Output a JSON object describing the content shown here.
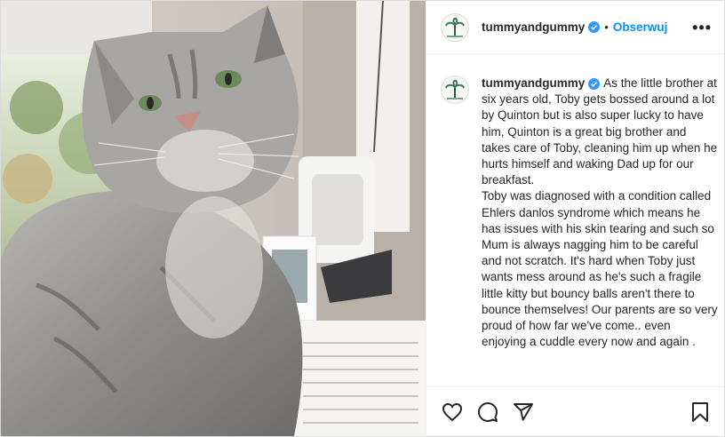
{
  "post": {
    "username": "tummyandgummy",
    "follow_label": "Obserwuj",
    "separator": "•",
    "more_label": "•••",
    "caption_username": "tummyandgummy",
    "caption_text": "As the little brother at six years old, Toby gets bossed around a lot by Quinton but is also super lucky to have him, Quinton is a great big brother and takes care of Toby, cleaning him up when he hurts himself and waking Dad up for our breakfast.\nToby was diagnosed with a condition called Ehlers danlos syndrome which means he has issues with his skin tearing and such so Mum is always nagging him to be careful and not scratch. It's hard when Toby just wants mess around as he's such a fragile little kitty but bouncy balls aren't there to bounce themselves! Our parents are so very proud of how far we've come.. even enjoying a cuddle every now and again ."
  },
  "icons": {
    "verified": "verified-badge-icon",
    "like": "heart-icon",
    "comment": "comment-icon",
    "share": "paper-plane-icon",
    "save": "bookmark-icon",
    "more": "more-options-icon"
  },
  "colors": {
    "link_blue": "#0095f6",
    "text": "#262626",
    "border": "#dbdbdb"
  }
}
